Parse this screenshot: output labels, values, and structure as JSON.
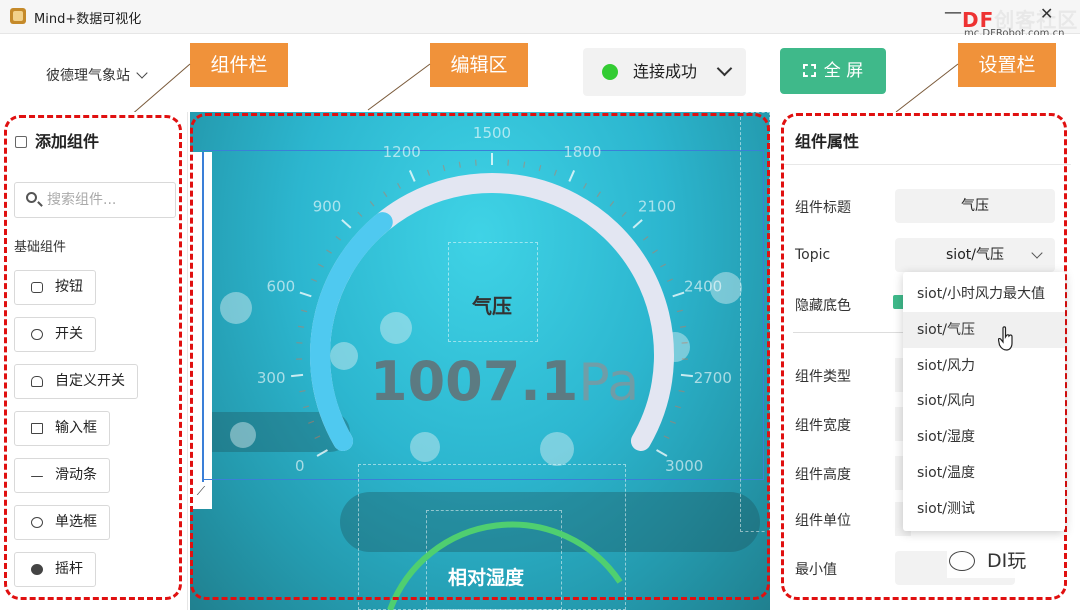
{
  "window": {
    "title": "Mind+数据可视化",
    "minimize": "—",
    "close": "✕"
  },
  "watermark": {
    "brand_main": "DF",
    "brand_rest": "创客社区",
    "url": "mc.DFRobot.com.cn"
  },
  "header": {
    "station": "彼德理气象站",
    "connection": "连接成功",
    "fullscreen": "全 屏",
    "callouts": {
      "component_bar": "组件栏",
      "editor": "编辑区",
      "settings": "设置栏"
    }
  },
  "left_panel": {
    "title": "添加组件",
    "search_placeholder": "搜索组件...",
    "section": "基础组件",
    "items": [
      {
        "label": "按钮",
        "icon": "button-icon"
      },
      {
        "label": "开关",
        "icon": "toggle-icon"
      },
      {
        "label": "自定义开关",
        "icon": "hand-icon"
      },
      {
        "label": "输入框",
        "icon": "input-icon"
      },
      {
        "label": "滑动条",
        "icon": "slider-icon"
      },
      {
        "label": "单选框",
        "icon": "radio-icon"
      },
      {
        "label": "摇杆",
        "icon": "joystick-icon"
      }
    ]
  },
  "gauge": {
    "title": "气压",
    "value": "1007.1",
    "unit": "Pa",
    "ticks": [
      "0",
      "300",
      "600",
      "900",
      "1200",
      "1500",
      "1800",
      "2100",
      "2400",
      "2700",
      "3000"
    ],
    "min": 0,
    "max": 3000,
    "current": 1007.1,
    "colors": {
      "fill": "#4fc9f0",
      "track": "#e3e6f2"
    }
  },
  "second_widget": {
    "title": "相对湿度"
  },
  "right_panel": {
    "title": "组件属性",
    "fields": {
      "title_label": "组件标题",
      "title_value": "气压",
      "topic_label": "Topic",
      "topic_value": "siot/气压",
      "hide_bg_label": "隐藏底色",
      "type_label": "组件类型",
      "width_label": "组件宽度",
      "height_label": "组件高度",
      "unit_label": "组件单位",
      "min_label": "最小值"
    }
  },
  "topic_dropdown": {
    "options": [
      "siot/小时风力最大值",
      "siot/气压",
      "siot/风力",
      "siot/风向",
      "siot/湿度",
      "siot/温度",
      "siot/测试"
    ],
    "hovered": "siot/气压"
  },
  "badge": {
    "text": "DI玩"
  }
}
